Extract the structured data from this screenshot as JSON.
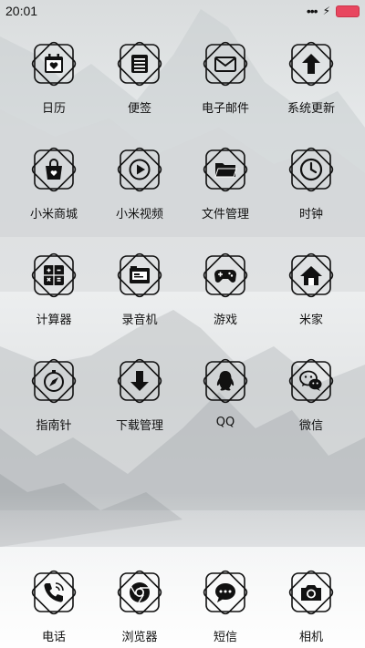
{
  "status_bar": {
    "time": "20:01",
    "signal": "•••",
    "charge": "⚡"
  },
  "apps": [
    {
      "label": "日历",
      "icon": "calendar-heart-icon"
    },
    {
      "label": "便签",
      "icon": "notes-icon"
    },
    {
      "label": "电子邮件",
      "icon": "envelope-icon"
    },
    {
      "label": "系统更新",
      "icon": "arrow-up-icon"
    },
    {
      "label": "小米商城",
      "icon": "shopping-bag-icon"
    },
    {
      "label": "小米视频",
      "icon": "play-circle-icon"
    },
    {
      "label": "文件管理",
      "icon": "folder-icon"
    },
    {
      "label": "时钟",
      "icon": "clock-icon"
    },
    {
      "label": "计算器",
      "icon": "calculator-icon"
    },
    {
      "label": "录音机",
      "icon": "recorder-icon"
    },
    {
      "label": "游戏",
      "icon": "gamepad-icon"
    },
    {
      "label": "米家",
      "icon": "home-icon"
    },
    {
      "label": "指南针",
      "icon": "compass-icon"
    },
    {
      "label": "下载管理",
      "icon": "download-icon"
    },
    {
      "label": "QQ",
      "icon": "qq-penguin-icon"
    },
    {
      "label": "微信",
      "icon": "wechat-icon"
    }
  ],
  "dock": [
    {
      "label": "电话",
      "icon": "phone-icon"
    },
    {
      "label": "浏览器",
      "icon": "browser-icon"
    },
    {
      "label": "短信",
      "icon": "message-icon"
    },
    {
      "label": "相机",
      "icon": "camera-icon"
    }
  ]
}
